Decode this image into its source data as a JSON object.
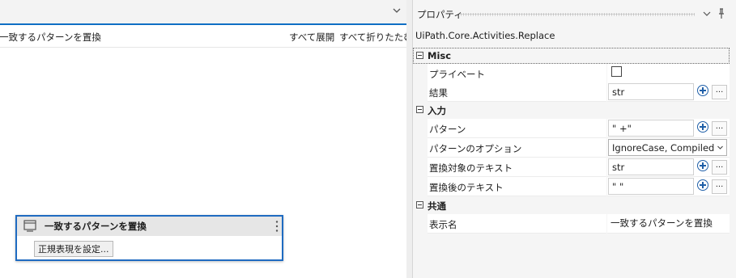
{
  "designer": {
    "breadcrumb": "一致するパターンを置換",
    "expand_all": "すべて展開",
    "collapse_all": "すべて折りたたむ",
    "activity": {
      "title": "一致するパターンを置換",
      "button_label": "正規表現を設定..."
    }
  },
  "properties": {
    "panel_title": "プロパティ",
    "type_name": "UiPath.Core.Activities.Replace",
    "categories": [
      {
        "label": "Misc",
        "rows": [
          {
            "name": "プライベート",
            "kind": "checkbox",
            "checked": false
          },
          {
            "name": "結果",
            "kind": "expr",
            "value": "str"
          }
        ]
      },
      {
        "label": "入力",
        "rows": [
          {
            "name": "パターン",
            "kind": "expr",
            "value": "\" +\""
          },
          {
            "name": "パターンのオプション",
            "kind": "combo",
            "value": "IgnoreCase, Compiled"
          },
          {
            "name": "置換対象のテキスト",
            "kind": "expr",
            "value": "str"
          },
          {
            "name": "置換後のテキスト",
            "kind": "expr",
            "value": "\" \""
          }
        ]
      },
      {
        "label": "共通",
        "rows": [
          {
            "name": "表示名",
            "kind": "text",
            "value": "一致するパターンを置換"
          }
        ]
      }
    ],
    "button_glyphs": {
      "add": "plus-circle-icon",
      "more": "..."
    }
  },
  "colors": {
    "accent": "#0e6fc4",
    "activity_border": "#1f6bc1",
    "plus": "#1f5fa8"
  }
}
